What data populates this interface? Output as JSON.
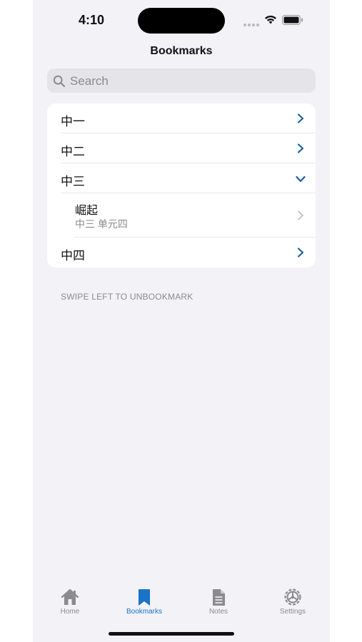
{
  "status": {
    "time": "4:10"
  },
  "nav": {
    "title": "Bookmarks"
  },
  "search": {
    "placeholder": "Search",
    "value": ""
  },
  "bookmarks": {
    "groups": [
      {
        "label": "中一",
        "expanded": false
      },
      {
        "label": "中二",
        "expanded": false
      },
      {
        "label": "中三",
        "expanded": true,
        "children": [
          {
            "title": "崛起",
            "subtitle": "中三 单元四"
          }
        ]
      },
      {
        "label": "中四",
        "expanded": false
      }
    ],
    "footer": "SWIPE LEFT TO UNBOOKMARK"
  },
  "tabs": [
    {
      "label": "Home",
      "icon": "house-icon"
    },
    {
      "label": "Bookmarks",
      "icon": "bookmark-icon",
      "active": true
    },
    {
      "label": "Notes",
      "icon": "document-icon"
    },
    {
      "label": "Settings",
      "icon": "gear-icon"
    }
  ],
  "colors": {
    "accent": "#1a73c8",
    "background": "#f2f2f7",
    "chevron": "#1f5fa0"
  }
}
